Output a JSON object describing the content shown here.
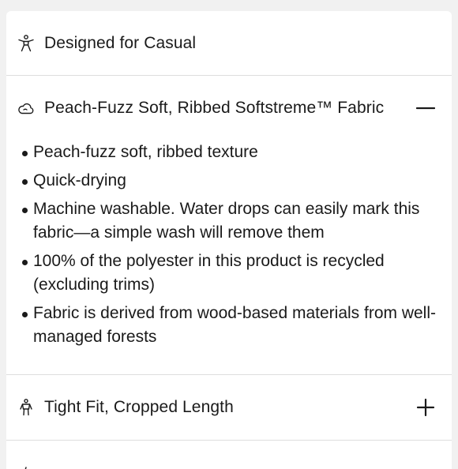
{
  "sections": [
    {
      "title": "Designed for Casual",
      "icon": "person-arms-out-icon"
    },
    {
      "title": "Peach-Fuzz Soft, Ribbed Softstreme™ Fabric",
      "icon": "cloud-icon",
      "state": "expanded",
      "toggle_icon": "minus-icon",
      "bullets": [
        "Peach-fuzz soft, ribbed texture",
        "Quick-drying",
        "Machine washable. Water drops can easily mark this fabric—a simple wash will remove them",
        "100% of the polyester in this product is recycled (excluding trims)",
        "Fabric is derived from wood-based materials from well-managed forests"
      ]
    },
    {
      "title": "Tight Fit, Cropped Length",
      "icon": "body-fit-icon",
      "state": "collapsed",
      "toggle_icon": "plus-icon"
    }
  ],
  "colors": {
    "page_background": "#f1f1f1",
    "panel_background": "#ffffff",
    "text": "#1a1a1a",
    "divider": "#dedede"
  }
}
